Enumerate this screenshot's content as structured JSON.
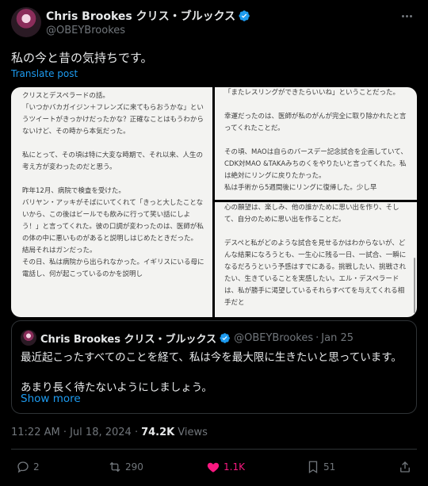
{
  "author": {
    "name": "Chris Brookes クリス・ブルックス",
    "handle": "@OBEYBrookes",
    "avatar_icon": "avatar-image",
    "verified_icon": "verified-badge-icon"
  },
  "post": {
    "text": "私の今と昔の気持ちです。",
    "translate_label": "Translate post"
  },
  "images": {
    "left_text": "クリスとデスペラードの話。\n「いつかバカガイジン＋フレンズに来てもらおうかな」というツイートがきっかけだったかな？正確なことはもうわからないけど、その時から本気だった。\n\n私にとって、その頃は特に大変な時期で、それ以来、人生の考え方が変わったのだと思う。\n\n昨年12月、病院で検査を受けた。\nバリヤン・アッキがそばにいてくれて「きっと大したことないから、この後はビールでも飲みに行って笑い話にしよう！」と言ってくれた。彼の口調が変わったのは、医師が私の体の中に悪いものがあると説明しはじめたときだった。\n結局それはガンだった。\nその日、私は病院から出られなかった。イギリスにいる母に電話し、何が起こっているのかを説明し",
    "right_top_text": "「またレスリングができたらいいね」ということだった。\n\n幸運だったのは、医師が私のがんが完全に取り除かれたと言ってくれたことだ。\n\nその頃、MAOは自らのバースデー記念試合を企画していて、CDK対MAO &TAKAみちのくをやりたいと言ってくれた。私は絶対にリングに戻りたかった。\n私は手術から5週間後にリングに復帰した。少し早",
    "right_bottom_text": "心の願望は、楽しみ、他の誰かために思い出を作り、そして、自分のために思い出を作ることだ。\n\nデスペと私がどのような試合を見せるかはわからないが、どんな結果になろうとも、一生心に残る一日、一試合、一瞬になるだろうという予感はすでにある。挑戦したい、挑戦されたい、生きていることを実感したい。エル・デスペラードは、私が勝手に渇望しているそれらすべてを与えてくれる相手だと"
  },
  "quote": {
    "name": "Chris Brookes クリス・ブルックス",
    "handle": "@OBEYBrookes",
    "separator": "·",
    "date": "Jan 25",
    "text1": "最近起こったすべてのことを経て、私は今を最大限に生きたいと思っています。",
    "text2": "あまり長く待たないようにしましょう。",
    "show_more": "Show more"
  },
  "meta": {
    "time": "11:22 AM · Jul 18, 2024 ·",
    "views_count": "74.2K",
    "views_label": "Views"
  },
  "actions": {
    "replies": "2",
    "reposts": "290",
    "likes": "1.1K",
    "bookmarks": "51"
  },
  "colors": {
    "background": "#000000",
    "text": "#e7e9ea",
    "muted": "#71767b",
    "link": "#1d9bf0",
    "like": "#f91880",
    "border": "#2f3336"
  }
}
